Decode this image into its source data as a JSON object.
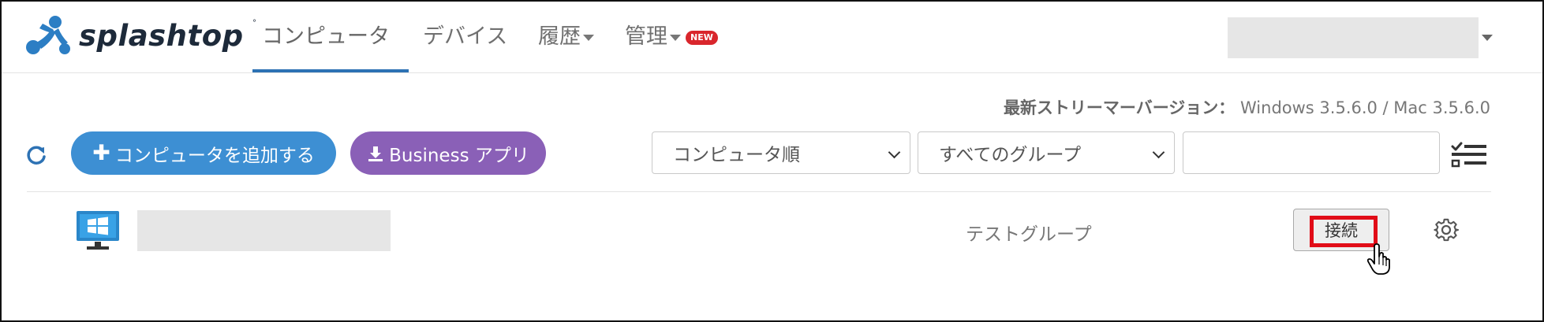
{
  "header": {
    "logo_text": "splashtop",
    "nav": [
      {
        "label": "コンピュータ",
        "active": true
      },
      {
        "label": "デバイス"
      },
      {
        "label": "履歴",
        "has_dropdown": true
      },
      {
        "label": "管理",
        "has_dropdown": true,
        "badge": "NEW"
      }
    ]
  },
  "version_info": {
    "label": "最新ストリーマーバージョン：",
    "value": "Windows 3.5.6.0 / Mac 3.5.6.0"
  },
  "toolbar": {
    "add_computer_label": "コンピュータを追加する",
    "business_app_label": "Business アプリ",
    "sort_select_value": "コンピュータ順",
    "group_select_value": "すべてのグループ",
    "search_value": ""
  },
  "computers": [
    {
      "group": "テストグループ",
      "connect_label": "接続"
    }
  ],
  "colors": {
    "accent_blue": "#2d72b4",
    "add_button": "#3d8fd3",
    "app_button": "#8a60b7",
    "badge_red": "#d9262c",
    "highlight_red": "#e10c17"
  }
}
